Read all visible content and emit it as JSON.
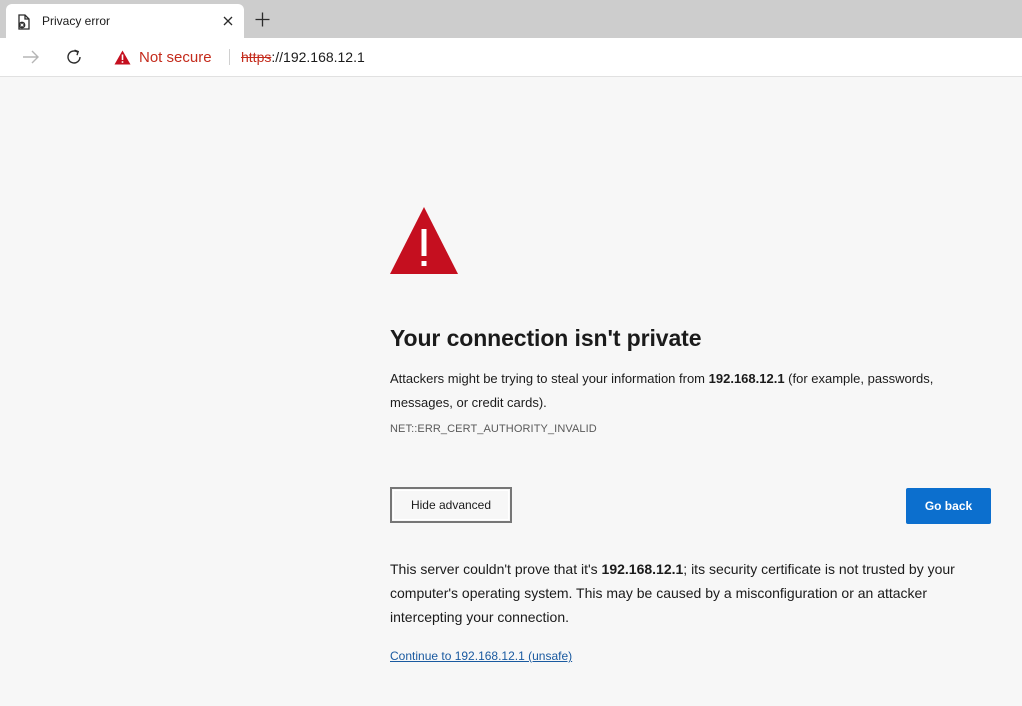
{
  "browser": {
    "tab": {
      "title": "Privacy error",
      "favicon": "error-document-icon"
    },
    "new_tab_icon": "plus-icon",
    "security_label": "Not secure",
    "url": {
      "scheme": "https",
      "rest": "://192.168.12.1"
    }
  },
  "page": {
    "heading": "Your connection isn't private",
    "message_before": "Attackers might be trying to steal your information from ",
    "host": "192.168.12.1",
    "message_after": " (for example, passwords, messages, or credit cards).",
    "error_code": "NET::ERR_CERT_AUTHORITY_INVALID",
    "hide_advanced_label": "Hide advanced",
    "go_back_label": "Go back",
    "details_before": "This server couldn't prove that it's ",
    "details_after": "; its security certificate is not trusted by your computer's operating system. This may be caused by a misconfiguration or an attacker intercepting your connection.",
    "proceed_link": "Continue to 192.168.12.1 (unsafe)"
  },
  "colors": {
    "warning_red": "#c50f1f",
    "accent_blue": "#0c6fce",
    "link_blue": "#1a5aa0"
  }
}
